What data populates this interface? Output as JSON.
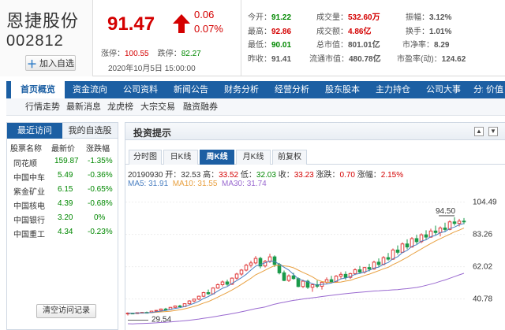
{
  "stock": {
    "name": "恩捷股份",
    "code": "002812",
    "add_label": "加入自选",
    "price": "91.47",
    "change": "0.06",
    "change_pct": "0.07%",
    "limit_up_label": "涨停：",
    "limit_up": "100.55",
    "limit_down_label": "跌停：",
    "limit_down": "82.27",
    "datetime": "2020年10月5日 15:00:00"
  },
  "quote": {
    "open_label": "今开：",
    "open": "91.22",
    "high_label": "最高：",
    "high": "92.86",
    "low_label": "最低：",
    "low": "90.01",
    "prev_label": "昨收：",
    "prev": "91.41",
    "vol_label": "成交量：",
    "vol": "532.60万",
    "amount_label": "成交额：",
    "amount": "4.86亿",
    "mcap_label": "总市值：",
    "mcap": "801.01亿",
    "float_label": "流通市值：",
    "float": "480.78亿",
    "amp_label": "振幅：",
    "amp": "3.12%",
    "turnover_label": "换手：",
    "turnover": "1.01%",
    "pb_label": "市净率：",
    "pb": "8.29",
    "pe_label": "市盈率(动)：",
    "pe": "124.62"
  },
  "nav": [
    "首页概览",
    "资金流向",
    "公司资料",
    "新闻公告",
    "财务分析",
    "经营分析",
    "股东股本",
    "主力持仓",
    "公司大事",
    "分红融资",
    "价值"
  ],
  "subnav": [
    "行情走势",
    "最新消息",
    "龙虎榜",
    "大宗交易",
    "融资融券"
  ],
  "left": {
    "tab_recent": "最近访问",
    "tab_fav": "我的自选股",
    "headers": [
      "股票名称",
      "最新价",
      "涨跌幅"
    ],
    "rows": [
      {
        "name": "同花顺",
        "price": "159.87",
        "pct": "-1.35%"
      },
      {
        "name": "中国中车",
        "price": "5.49",
        "pct": "-0.36%"
      },
      {
        "name": "紫金矿业",
        "price": "6.15",
        "pct": "-0.65%"
      },
      {
        "name": "中国核电",
        "price": "4.39",
        "pct": "-0.68%"
      },
      {
        "name": "中国银行",
        "price": "3.20",
        "pct": "0%"
      },
      {
        "name": "中国重工",
        "price": "4.34",
        "pct": "-0.23%"
      }
    ],
    "clear_label": "清空访问记录"
  },
  "panel": {
    "title": "投资提示",
    "btn_up": "▲",
    "btn_down": "▼",
    "tabs": [
      "分时图",
      "日K线",
      "周K线",
      "月K线",
      "前复权"
    ],
    "active_tab": 2,
    "ohlc": {
      "date": "20190930",
      "open_label": "开：",
      "open": "32.53",
      "high_label": "高：",
      "high": "33.52",
      "low_label": "低：",
      "low": "32.03",
      "close_label": "收：",
      "close": "33.23",
      "chg_label": "涨跌：",
      "chg": "0.70",
      "amp_label": "涨幅：",
      "amp": "2.15%"
    },
    "ma": {
      "ma5_label": "MA5:",
      "ma5": "31.91",
      "ma10_label": "MA10:",
      "ma10": "31.55",
      "ma30_label": "MA30:",
      "ma30": "31.74"
    }
  },
  "colors": {
    "up": "#d40000",
    "down": "#008800",
    "nav": "#1c5fa3",
    "candle_up": "#e03c3c",
    "candle_down": "#1a9a4a",
    "ma5": "#4a7fc1",
    "ma10": "#e8a040",
    "ma30": "#9a6ad0"
  },
  "chart_data": {
    "type": "candlestick",
    "y_ticks": [
      "104.49",
      "83.26",
      "62.02",
      "40.78"
    ],
    "y_tick_values": [
      104.49,
      83.26,
      62.02,
      40.78
    ],
    "ylim": [
      23,
      110
    ],
    "max_label": "94.50",
    "min_label": "29.54",
    "candles": [
      [
        31.0,
        32.0,
        30.0,
        31.5
      ],
      [
        31.5,
        31.8,
        30.8,
        31.2
      ],
      [
        31.2,
        32.0,
        30.9,
        31.8
      ],
      [
        31.8,
        32.3,
        31.4,
        32.0
      ],
      [
        32.0,
        32.5,
        31.6,
        31.9
      ],
      [
        31.9,
        33.0,
        31.5,
        32.8
      ],
      [
        32.8,
        33.6,
        32.2,
        33.3
      ],
      [
        33.3,
        34.5,
        33.0,
        34.2
      ],
      [
        34.2,
        35.0,
        33.8,
        34.0
      ],
      [
        34.0,
        35.5,
        33.7,
        35.3
      ],
      [
        35.3,
        36.5,
        35.0,
        36.2
      ],
      [
        36.2,
        37.0,
        35.5,
        35.8
      ],
      [
        35.8,
        38.0,
        35.6,
        37.7
      ],
      [
        37.7,
        40.0,
        37.2,
        39.5
      ],
      [
        39.5,
        41.0,
        38.6,
        40.7
      ],
      [
        40.7,
        43.0,
        40.0,
        42.6
      ],
      [
        42.6,
        45.5,
        42.0,
        45.0
      ],
      [
        45.0,
        47.0,
        43.5,
        44.2
      ],
      [
        44.2,
        48.5,
        43.8,
        48.0
      ],
      [
        48.0,
        51.0,
        47.5,
        50.2
      ],
      [
        50.2,
        53.0,
        49.0,
        52.0
      ],
      [
        52.0,
        53.5,
        49.5,
        50.5
      ],
      [
        50.5,
        55.0,
        50.0,
        54.5
      ],
      [
        54.5,
        58.0,
        53.5,
        57.2
      ],
      [
        57.2,
        60.5,
        56.0,
        59.8
      ],
      [
        59.8,
        64.0,
        59.0,
        63.0
      ],
      [
        63.0,
        66.0,
        61.5,
        64.5
      ],
      [
        64.5,
        69.0,
        63.5,
        67.5
      ],
      [
        67.5,
        68.5,
        61.0,
        62.5
      ],
      [
        62.5,
        66.5,
        61.5,
        65.5
      ],
      [
        65.5,
        70.5,
        64.5,
        68.5
      ],
      [
        68.5,
        69.5,
        62.0,
        63.5
      ],
      [
        63.5,
        64.5,
        57.0,
        58.0
      ],
      [
        58.0,
        59.5,
        52.5,
        53.0
      ],
      [
        53.0,
        57.0,
        52.0,
        56.0
      ],
      [
        56.0,
        58.0,
        53.5,
        54.2
      ],
      [
        54.2,
        55.0,
        48.5,
        49.0
      ],
      [
        49.0,
        53.5,
        48.0,
        52.5
      ],
      [
        52.5,
        53.5,
        47.5,
        48.5
      ],
      [
        48.5,
        51.0,
        45.5,
        50.2
      ],
      [
        50.2,
        53.0,
        48.0,
        49.2
      ],
      [
        49.2,
        52.5,
        47.0,
        51.8
      ],
      [
        51.8,
        55.0,
        50.5,
        53.5
      ],
      [
        53.5,
        56.0,
        51.0,
        52.0
      ],
      [
        52.0,
        56.5,
        51.5,
        55.8
      ],
      [
        55.8,
        58.5,
        54.0,
        57.0
      ],
      [
        57.0,
        59.0,
        53.5,
        55.0
      ],
      [
        55.0,
        58.0,
        54.0,
        57.5
      ],
      [
        57.5,
        61.0,
        56.5,
        60.0
      ],
      [
        60.0,
        62.5,
        57.5,
        58.5
      ],
      [
        58.5,
        62.0,
        57.5,
        61.5
      ],
      [
        61.5,
        64.0,
        59.0,
        60.5
      ],
      [
        60.5,
        66.0,
        60.0,
        65.0
      ],
      [
        65.0,
        67.5,
        62.0,
        63.5
      ],
      [
        63.5,
        69.0,
        63.0,
        68.0
      ],
      [
        68.0,
        71.0,
        66.0,
        67.0
      ],
      [
        67.0,
        74.0,
        66.5,
        73.0
      ],
      [
        73.0,
        76.0,
        70.0,
        71.5
      ],
      [
        71.5,
        78.0,
        71.0,
        77.0
      ],
      [
        77.0,
        80.0,
        73.5,
        75.0
      ],
      [
        75.0,
        81.5,
        74.5,
        80.5
      ],
      [
        80.5,
        83.0,
        77.0,
        78.5
      ],
      [
        78.5,
        84.0,
        77.5,
        83.0
      ],
      [
        83.0,
        86.0,
        79.5,
        81.5
      ],
      [
        81.5,
        87.0,
        81.0,
        85.5
      ],
      [
        85.5,
        89.0,
        83.0,
        84.5
      ],
      [
        84.5,
        88.5,
        82.0,
        87.5
      ],
      [
        87.5,
        91.0,
        85.0,
        86.5
      ],
      [
        86.5,
        92.5,
        86.0,
        91.5
      ],
      [
        91.5,
        94.5,
        89.0,
        90.5
      ],
      [
        90.5,
        93.5,
        88.5,
        92.0
      ],
      [
        92.0,
        94.0,
        90.0,
        91.5
      ]
    ]
  }
}
